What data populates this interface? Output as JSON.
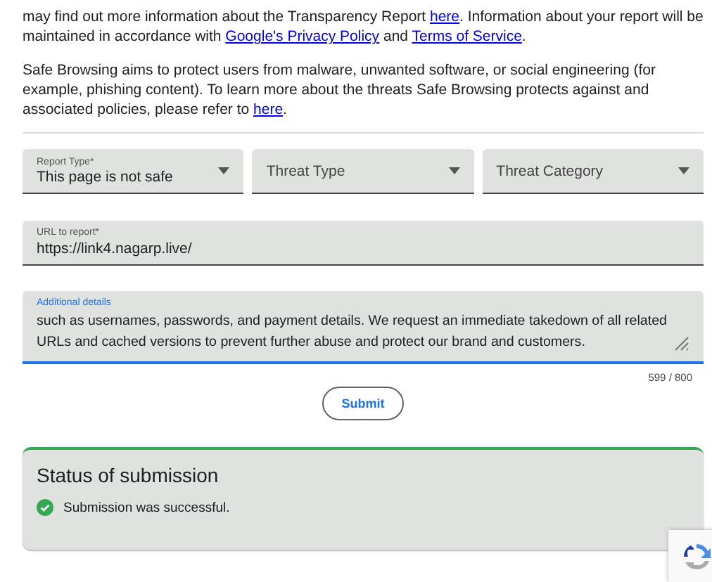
{
  "intro_paragraphs": [
    {
      "parts": [
        {
          "kind": "text",
          "text": "may find out more information about the Transparency Report "
        },
        {
          "kind": "link",
          "text": "here"
        },
        {
          "kind": "text",
          "text": ". Information about your report will be maintained in accordance with "
        },
        {
          "kind": "link",
          "text": "Google's Privacy Policy"
        },
        {
          "kind": "text",
          "text": " and "
        },
        {
          "kind": "link",
          "text": "Terms of Service"
        },
        {
          "kind": "text",
          "text": "."
        }
      ]
    },
    {
      "parts": [
        {
          "kind": "text",
          "text": "Safe Browsing aims to protect users from malware, unwanted software, or social engineering (for example, phishing content). To learn more about the threats Safe Browsing protects against and associated policies, please refer to "
        },
        {
          "kind": "link",
          "text": "here"
        },
        {
          "kind": "text",
          "text": "."
        }
      ]
    }
  ],
  "selects": [
    {
      "label": "Report Type*",
      "value": "This page is not safe"
    },
    {
      "placeholder": "Threat Type"
    },
    {
      "placeholder": "Threat Category"
    }
  ],
  "url_field": {
    "label": "URL to report*",
    "value": "https://link4.nagarp.live/"
  },
  "details_field": {
    "label": "Additional details",
    "value": "such as usernames, passwords, and payment details. We request an immediate takedown of all related URLs and cached versions to prevent further abuse and protect our brand and customers.",
    "focused": true,
    "counter": "599 / 800"
  },
  "submit_button": "Submit",
  "status": {
    "title": "Status of submission",
    "message": "Submission was successful.",
    "success": true
  }
}
